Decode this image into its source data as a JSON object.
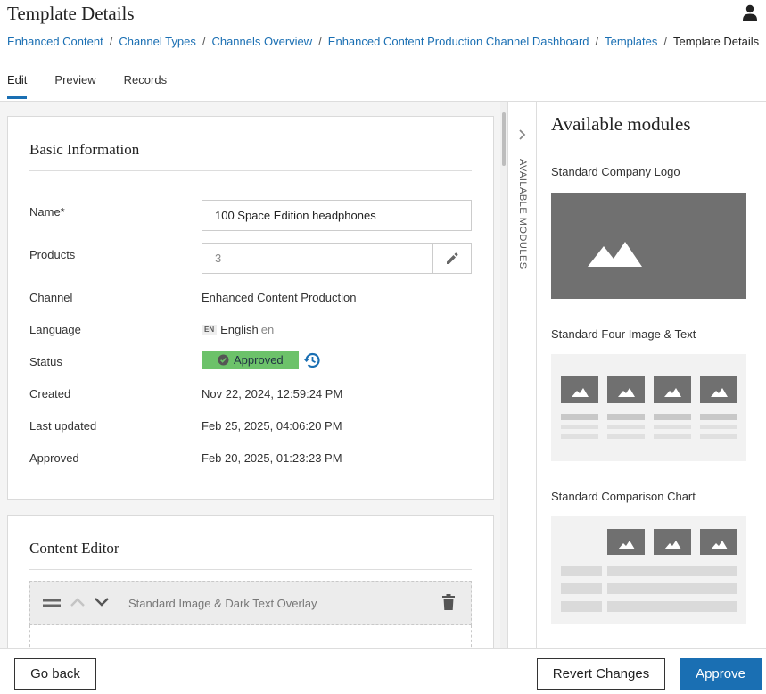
{
  "header": {
    "title": "Template Details",
    "user_icon": "user-icon",
    "breadcrumb": [
      {
        "label": "Enhanced Content"
      },
      {
        "label": "Channel Types"
      },
      {
        "label": "Channels Overview"
      },
      {
        "label": "Enhanced Content Production Channel Dashboard"
      },
      {
        "label": "Templates"
      }
    ],
    "breadcrumb_current": "Template Details",
    "breadcrumb_separator": "/",
    "tabs": [
      {
        "label": "Edit",
        "active": true
      },
      {
        "label": "Preview",
        "active": false
      },
      {
        "label": "Records",
        "active": false
      }
    ]
  },
  "basic_info": {
    "title": "Basic Information",
    "name_label": "Name*",
    "name_value": "100 Space Edition headphones",
    "products_label": "Products",
    "products_value": "3",
    "channel_label": "Channel",
    "channel_value": "Enhanced Content Production",
    "language_label": "Language",
    "language_badge": "EN",
    "language_value": "English",
    "language_code": "en",
    "status_label": "Status",
    "status_value": "Approved",
    "created_label": "Created",
    "created_value": "Nov 22, 2024, 12:59:24 PM",
    "last_updated_label": "Last updated",
    "last_updated_value": "Feb 25, 2025, 04:06:20 PM",
    "approved_label": "Approved",
    "approved_value": "Feb 20, 2025, 01:23:23 PM"
  },
  "content_editor": {
    "title": "Content Editor",
    "module_name": "Standard Image & Dark Text Overlay"
  },
  "side_panel": {
    "toggle_label": "AVAILABLE MODULES",
    "title": "Available modules",
    "modules": [
      {
        "label": "Standard Company Logo"
      },
      {
        "label": "Standard Four Image & Text"
      },
      {
        "label": "Standard Comparison Chart"
      }
    ]
  },
  "footer": {
    "go_back": "Go back",
    "revert": "Revert Changes",
    "approve": "Approve"
  },
  "colors": {
    "link": "#1a6fb3",
    "primary": "#1a6fb3",
    "status_approved": "#6cc26a",
    "placeholder_dark": "#707070",
    "placeholder_light": "#f2f2f2"
  }
}
